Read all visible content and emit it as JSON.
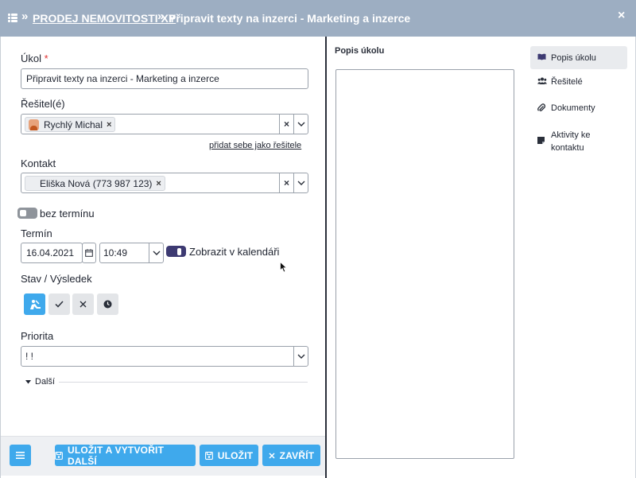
{
  "header": {
    "breadcrumb_separator": "»",
    "breadcrumb": "PRODEJ NEMOVITOSTI XY",
    "title": "Připravit texty na inzerci - Marketing a inzerce",
    "close": "×"
  },
  "form": {
    "ukol": {
      "label": "Úkol",
      "required_mark": "*",
      "value": "Připravit texty na inzerci - Marketing a inzerce"
    },
    "resitele": {
      "label": "Řešitel(é)",
      "tag": "Rychlý Michal",
      "add_self_link": "přidat sebe jako řešitele"
    },
    "kontakt": {
      "label": "Kontakt",
      "tag": "Eliška Nová (773 987 123)"
    },
    "bez_terminu": {
      "label": "bez termínu"
    },
    "termin": {
      "label": "Termín",
      "date": "16.04.2021",
      "time": "10:49",
      "calendar_label": "Zobrazit v kalendáři"
    },
    "stav": {
      "label": "Stav / Výsledek"
    },
    "priorita": {
      "label": "Priorita",
      "value": "! !"
    },
    "dalsi": {
      "label": "Další"
    },
    "clear_symbol": "×",
    "tag_remove": "×"
  },
  "footer": {
    "save_new": "ULOŽIT A VYTVOŘIT DALŠÍ",
    "save": "ULOŽIT",
    "close": "ZAVŘÍT"
  },
  "popis": {
    "label": "Popis úkolu"
  },
  "sidebar": {
    "items": [
      {
        "label": "Popis úkolu",
        "icon": "book-icon"
      },
      {
        "label": "Řešitelé",
        "icon": "users-icon"
      },
      {
        "label": "Dokumenty",
        "icon": "paperclip-icon"
      },
      {
        "label": "Aktivity ke kontaktu",
        "icon": "note-icon"
      }
    ]
  },
  "colors": {
    "header": "#9daec2",
    "accent": "#3fa9ec",
    "toggle_on": "#3d3a72",
    "toggle_off": "#8f949b"
  }
}
